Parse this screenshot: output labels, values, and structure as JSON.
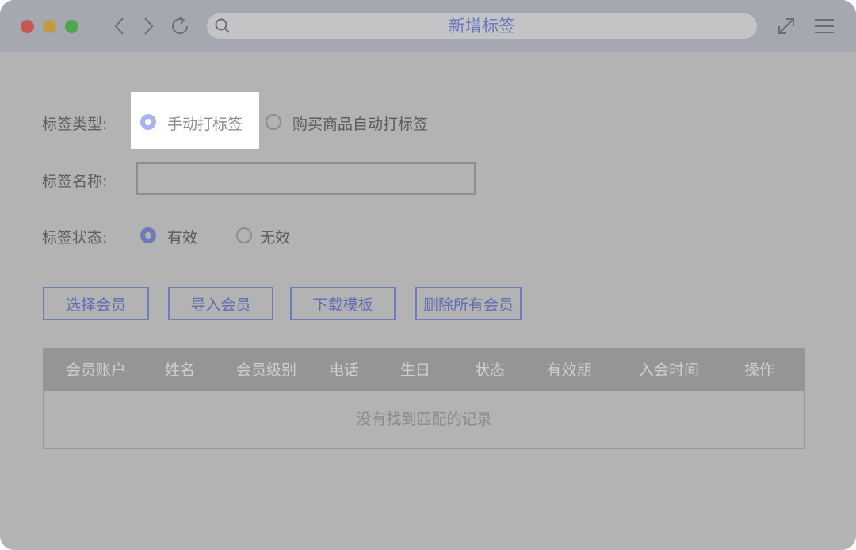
{
  "window": {
    "title": "新增标签"
  },
  "icons": {
    "back": "chevron-left-icon",
    "forward": "chevron-right-icon",
    "reload": "reload-icon",
    "search": "search-icon",
    "expand": "expand-icon",
    "menu": "hamburger-menu-icon"
  },
  "form": {
    "tag_type": {
      "label": "标签类型:",
      "options": [
        {
          "label": "手动打标签",
          "selected": true
        },
        {
          "label": "购买商品自动打标签",
          "selected": false
        }
      ]
    },
    "tag_name": {
      "label": "标签名称:",
      "value": "",
      "placeholder": ""
    },
    "tag_status": {
      "label": "标签状态:",
      "options": [
        {
          "label": "有效",
          "selected": true
        },
        {
          "label": "无效",
          "selected": false
        }
      ]
    }
  },
  "buttons": {
    "select_members": "选择会员",
    "import_members": "导入会员",
    "download_template": "下载模板",
    "delete_all_members": "删除所有会员"
  },
  "table": {
    "columns": [
      "会员账户",
      "姓名",
      "会员级别",
      "电话",
      "生日",
      "状态",
      "有效期",
      "入会时间",
      "操作"
    ],
    "rows": [],
    "empty_text": "没有找到匹配的记录"
  },
  "colors": {
    "accent": "#6d79b9",
    "highlight_radio": "#a8b3ef",
    "overlay_background": "#b3b3b3"
  }
}
